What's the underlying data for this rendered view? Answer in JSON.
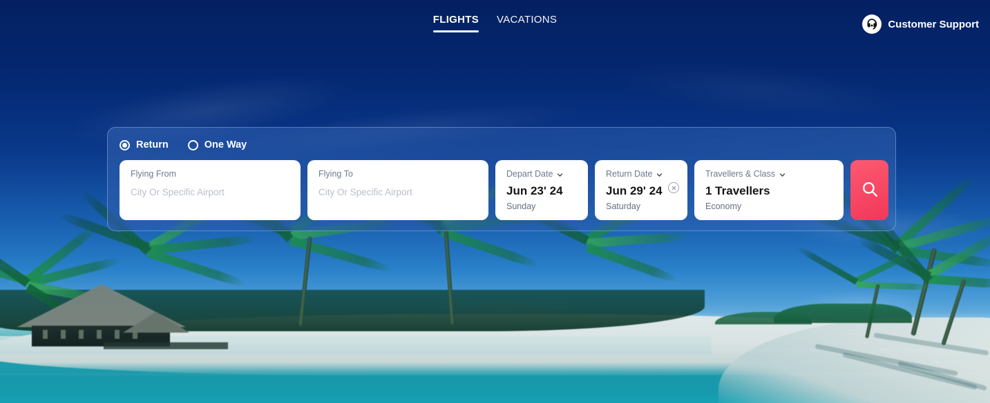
{
  "nav": {
    "tabs": [
      {
        "label": "FLIGHTS",
        "active": true
      },
      {
        "label": "VACATIONS",
        "active": false
      }
    ],
    "support": {
      "label": "Customer Support",
      "icon": "headset-icon"
    }
  },
  "search_panel": {
    "trip_types": [
      {
        "label": "Return",
        "selected": true
      },
      {
        "label": "One Way",
        "selected": false
      }
    ],
    "origin": {
      "label": "Flying From",
      "value": "",
      "placeholder": "City Or Specific Airport"
    },
    "destination": {
      "label": "Flying To",
      "value": "",
      "placeholder": "City Or Specific Airport"
    },
    "depart_date": {
      "label": "Depart Date",
      "value": "Jun 23' 24",
      "weekday": "Sunday",
      "icon": "chevron-down-icon"
    },
    "return_date": {
      "label": "Return Date",
      "value": "Jun 29' 24",
      "weekday": "Saturday",
      "icon": "chevron-down-icon",
      "clear_icon": "clear-circle-icon"
    },
    "travellers": {
      "label": "Travellers & Class",
      "value": "1 Travellers",
      "class": "Economy",
      "icon": "chevron-down-icon"
    },
    "search_button": {
      "icon": "search-icon",
      "label": ""
    }
  },
  "colors": {
    "accent_red": "#f8475f",
    "sky_navy": "#032169",
    "panel_blue": "#3160b0",
    "lagoon_teal": "#1f9fae",
    "white": "#ffffff",
    "label_gray": "#6b7a8f",
    "placeholder_gray": "#b9bfc7"
  },
  "background": {
    "scene": "tropical-beach-with-palm-trees-and-thatched-hut"
  }
}
